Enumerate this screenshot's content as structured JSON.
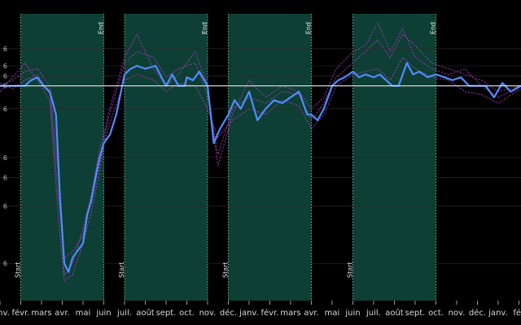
{
  "chart_data": {
    "type": "line",
    "title": "",
    "xlabel": "",
    "ylabel": "",
    "x_axis": {
      "type": "month-index",
      "range": [
        0,
        25.1
      ],
      "tick_labels": [
        "janv.",
        "févr.",
        "mars",
        "avr.",
        "mai",
        "juin",
        "juil.",
        "août",
        "sept.",
        "oct.",
        "nov.",
        "déc.",
        "janv.",
        "févr.",
        "mars",
        "avr.",
        "mai",
        "juin",
        "juil.",
        "août",
        "sept.",
        "oct.",
        "nov.",
        "déc.",
        "janv.",
        "fé"
      ]
    },
    "y_axis": {
      "range": [
        -0.75,
        0.3
      ],
      "gridlines": [
        0.13,
        0.07,
        0.035,
        0.0,
        -0.08,
        -0.25,
        -0.32,
        -0.42,
        -0.62
      ],
      "tick_labels": [
        "6",
        "6",
        "6",
        "6",
        "6",
        "6",
        "6",
        "6",
        "6",
        "6"
      ]
    },
    "reference_line": {
      "y": 0
    },
    "grid": true,
    "bands": [
      {
        "start": 1.0,
        "end": 5.0,
        "start_label": "Start",
        "end_label": "End"
      },
      {
        "start": 6.0,
        "end": 10.0,
        "start_label": "Start",
        "end_label": "End"
      },
      {
        "start": 11.0,
        "end": 15.0,
        "start_label": "Start",
        "end_label": "End"
      },
      {
        "start": 17.0,
        "end": 21.0,
        "start_label": "Start",
        "end_label": "End"
      }
    ],
    "series": [
      {
        "role": "median",
        "color": "#4f8dff",
        "x": [
          0,
          0.3,
          0.6,
          0.9,
          1.2,
          1.5,
          1.8,
          2.1,
          2.4,
          2.7,
          2.9,
          3.1,
          3.3,
          3.5,
          3.7,
          4.0,
          4.2,
          4.4,
          4.6,
          4.8,
          5.0,
          5.3,
          5.6,
          6.0,
          6.3,
          6.6,
          7.0,
          7.5,
          8.0,
          8.3,
          8.6,
          8.9,
          9.0,
          9.3,
          9.6,
          10.0,
          10.3,
          10.6,
          11.0,
          11.3,
          11.6,
          12.0,
          12.4,
          12.8,
          13.2,
          13.6,
          14.0,
          14.4,
          14.8,
          15.0,
          15.3,
          15.6,
          16.0,
          16.3,
          16.6,
          17.0,
          17.3,
          17.6,
          18.0,
          18.3,
          18.6,
          18.9,
          19.2,
          19.6,
          19.9,
          20.2,
          20.6,
          21.0,
          21.4,
          21.8,
          22.2,
          22.6,
          23.0,
          23.4,
          23.8,
          24.2,
          24.6,
          25.1
        ],
        "y": [
          0.0,
          0.0,
          0.0,
          0.0,
          0.0,
          0.02,
          0.03,
          0.0,
          -0.02,
          -0.1,
          -0.4,
          -0.62,
          -0.65,
          -0.6,
          -0.58,
          -0.55,
          -0.45,
          -0.4,
          -0.32,
          -0.25,
          -0.2,
          -0.17,
          -0.1,
          0.04,
          0.06,
          0.07,
          0.06,
          0.07,
          0.0,
          0.04,
          0.0,
          0.0,
          0.03,
          0.02,
          0.05,
          0.0,
          -0.2,
          -0.15,
          -0.1,
          -0.05,
          -0.08,
          -0.02,
          -0.12,
          -0.08,
          -0.05,
          -0.06,
          -0.04,
          -0.02,
          -0.1,
          -0.1,
          -0.12,
          -0.08,
          0.0,
          0.02,
          0.03,
          0.05,
          0.03,
          0.04,
          0.03,
          0.04,
          0.02,
          0.0,
          0.0,
          0.08,
          0.04,
          0.05,
          0.03,
          0.04,
          0.03,
          0.02,
          0.03,
          0.0,
          0.0,
          0.0,
          -0.04,
          0.01,
          -0.02,
          0.0
        ]
      },
      {
        "role": "individual",
        "color": "#b13cc5",
        "x": [
          0,
          0.6,
          1.2,
          1.8,
          2.4,
          2.8,
          3.1,
          3.5,
          4.0,
          4.4,
          4.8,
          5.2,
          6.0,
          6.6,
          7.4,
          8.0,
          8.6,
          9.4,
          10.0,
          10.5,
          11.2,
          12.0,
          12.8,
          13.6,
          14.4,
          15.0,
          15.6,
          16.2,
          17.0,
          17.6,
          18.2,
          18.8,
          19.4,
          20.0,
          20.8,
          21.6,
          22.4,
          23.2,
          24.0,
          25.1
        ],
        "y": [
          0.0,
          0.02,
          0.05,
          0.06,
          0.0,
          -0.3,
          -0.66,
          -0.62,
          -0.5,
          -0.38,
          -0.22,
          -0.12,
          0.08,
          0.12,
          0.1,
          0.03,
          0.06,
          0.08,
          -0.03,
          -0.24,
          -0.08,
          -0.04,
          -0.06,
          -0.02,
          -0.03,
          -0.12,
          -0.06,
          0.03,
          0.08,
          0.12,
          0.16,
          0.1,
          0.18,
          0.14,
          0.08,
          0.06,
          0.04,
          0.02,
          -0.02,
          0.0
        ]
      },
      {
        "role": "individual",
        "color": "#b13cc5",
        "x": [
          0,
          0.6,
          1.2,
          1.8,
          2.4,
          2.8,
          3.1,
          3.5,
          4.0,
          4.4,
          4.8,
          5.2,
          6.0,
          6.6,
          7.4,
          8.0,
          8.6,
          9.4,
          10.0,
          10.5,
          11.2,
          12.0,
          12.8,
          13.6,
          14.4,
          15.0,
          15.6,
          16.2,
          17.0,
          17.6,
          18.2,
          18.8,
          19.4,
          20.0,
          20.8,
          21.6,
          22.4,
          23.2,
          24.0,
          25.1
        ],
        "y": [
          0.01,
          -0.01,
          0.02,
          0.04,
          -0.03,
          -0.38,
          -0.6,
          -0.58,
          -0.52,
          -0.4,
          -0.27,
          -0.15,
          0.02,
          0.04,
          0.02,
          -0.02,
          0.01,
          0.0,
          -0.08,
          -0.18,
          -0.12,
          -0.08,
          -0.1,
          -0.05,
          -0.07,
          -0.15,
          -0.1,
          0.0,
          0.04,
          0.05,
          0.06,
          0.02,
          0.1,
          0.06,
          0.03,
          0.02,
          -0.02,
          -0.03,
          -0.06,
          -0.01
        ]
      },
      {
        "role": "individual",
        "color": "#b13cc5",
        "x": [
          0,
          0.6,
          1.2,
          1.8,
          2.4,
          2.8,
          3.1,
          3.5,
          4.0,
          4.4,
          4.8,
          5.2,
          6.0,
          6.6,
          7.4,
          8.0,
          8.6,
          9.4,
          10.0,
          10.5,
          11.2,
          12.0,
          12.8,
          13.6,
          14.4,
          15.0,
          15.6,
          16.2,
          17.0,
          17.6,
          18.2,
          18.8,
          19.4,
          20.0,
          20.8,
          21.6,
          22.4,
          23.2,
          24.0,
          25.1
        ],
        "y": [
          -0.02,
          0.03,
          0.08,
          0.02,
          -0.05,
          -0.45,
          -0.68,
          -0.66,
          -0.55,
          -0.44,
          -0.3,
          -0.1,
          0.1,
          0.18,
          0.06,
          0.0,
          0.04,
          0.12,
          0.0,
          -0.28,
          -0.1,
          0.02,
          -0.04,
          0.0,
          -0.02,
          -0.08,
          -0.04,
          0.06,
          0.12,
          0.14,
          0.22,
          0.12,
          0.2,
          0.1,
          0.06,
          0.04,
          0.06,
          0.0,
          -0.04,
          0.0
        ]
      }
    ]
  }
}
